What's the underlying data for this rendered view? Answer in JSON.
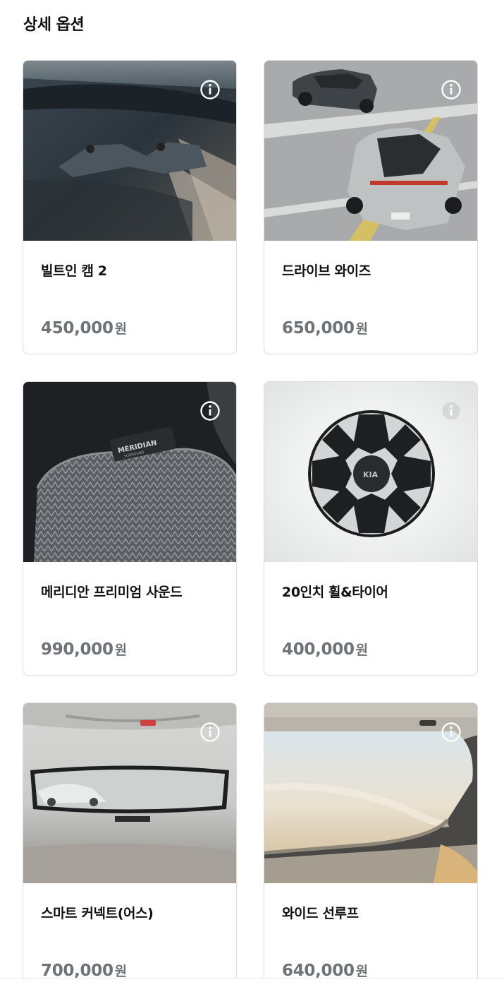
{
  "section": {
    "title": "상세 옵션"
  },
  "options": [
    {
      "name": "빌트인 캠 2",
      "price": "450,000",
      "unit": "원",
      "image": "builtin-cam-photo",
      "info_icon": "info-icon"
    },
    {
      "name": "드라이브 와이즈",
      "price": "650,000",
      "unit": "원",
      "image": "drive-wise-photo",
      "info_icon": "info-icon"
    },
    {
      "name": "메리디안 프리미엄 사운드",
      "price": "990,000",
      "unit": "원",
      "image": "meridian-speaker-photo",
      "info_icon": "info-icon"
    },
    {
      "name": "20인치 휠&타이어",
      "price": "400,000",
      "unit": "원",
      "image": "wheel-photo",
      "info_icon": "info-icon"
    },
    {
      "name": "스마트 커넥트(어스)",
      "price": "700,000",
      "unit": "원",
      "image": "rear-mirror-photo",
      "info_icon": "info-icon"
    },
    {
      "name": "와이드 선루프",
      "price": "640,000",
      "unit": "원",
      "image": "sunroof-photo",
      "info_icon": "info-icon"
    }
  ],
  "colors": {
    "price_text": "#6e7378",
    "card_border": "#dcdcdc",
    "title_text": "#111111"
  },
  "speaker_badge": {
    "brand": "MERIDIAN",
    "sub": "SURROUND"
  },
  "wheel_badge": "KIA"
}
